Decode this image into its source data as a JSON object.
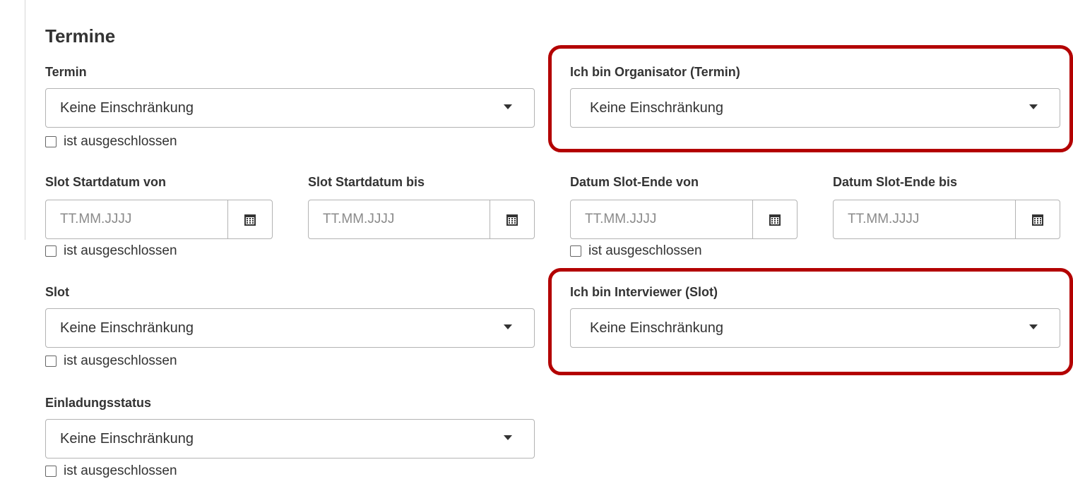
{
  "section": {
    "title": "Termine"
  },
  "filters": {
    "termin": {
      "label": "Termin",
      "value": "Keine Einschränkung",
      "excluded_label": "ist ausgeschlossen"
    },
    "organisator": {
      "label": "Ich bin Organisator (Termin)",
      "value": "Keine Einschränkung"
    },
    "slot_start_von": {
      "label": "Slot Startdatum von",
      "placeholder": "TT.MM.JJJJ",
      "excluded_label": "ist ausgeschlossen"
    },
    "slot_start_bis": {
      "label": "Slot Startdatum bis",
      "placeholder": "TT.MM.JJJJ"
    },
    "slot_ende_von": {
      "label": "Datum Slot-Ende von",
      "placeholder": "TT.MM.JJJJ",
      "excluded_label": "ist ausgeschlossen"
    },
    "slot_ende_bis": {
      "label": "Datum Slot-Ende bis",
      "placeholder": "TT.MM.JJJJ"
    },
    "slot": {
      "label": "Slot",
      "value": "Keine Einschränkung",
      "excluded_label": "ist ausgeschlossen"
    },
    "interviewer": {
      "label": "Ich bin Interviewer (Slot)",
      "value": "Keine Einschränkung"
    },
    "einladungsstatus": {
      "label": "Einladungsstatus",
      "value": "Keine Einschränkung",
      "excluded_label": "ist ausgeschlossen"
    }
  },
  "icons": {
    "dropdown": "chevron-down-icon",
    "date_picker": "calendar-icon"
  },
  "colors": {
    "highlight": "#b30000",
    "text": "#333333",
    "placeholder": "#8a8a8a",
    "border": "#b3b3b3"
  }
}
